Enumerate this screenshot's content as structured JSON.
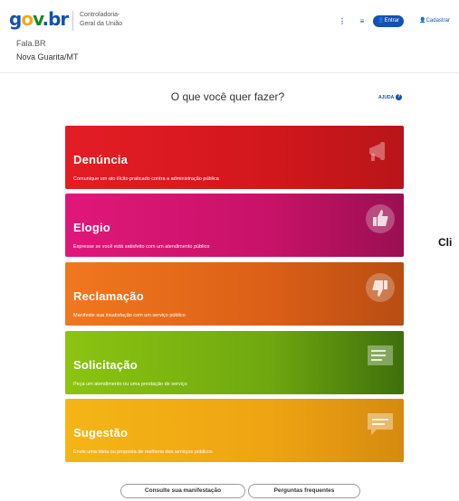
{
  "header": {
    "logo": {
      "g": "g",
      "o": "o",
      "v": "v",
      "br": ".br"
    },
    "org_line1": "Controladoria-",
    "org_line2": "Geral da União",
    "system": "Fala.BR",
    "city": "Nova Guarita/MT",
    "kebab": "⋮",
    "menu": "≡",
    "entrar": "Entrar",
    "cadastrar": "Cadastrar"
  },
  "main": {
    "question": "O que você quer fazer?",
    "help": "AJUDA",
    "help_icon": "?"
  },
  "cards": [
    {
      "title": "Denúncia",
      "desc": "Comunique um ato ilícito praticado contra a administração pública",
      "icon": "megaphone-icon",
      "color": "#d2171c"
    },
    {
      "title": "Elogio",
      "desc": "Expresse se você está satisfeito com um atendimento público",
      "icon": "thumbs-up-icon",
      "color": "#c81268"
    },
    {
      "title": "Reclamação",
      "desc": "Manifeste sua insatisfação com um serviço público",
      "icon": "thumbs-down-icon",
      "color": "#dc5f17"
    },
    {
      "title": "Solicitação",
      "desc": "Peça um atendimento ou uma prestação de serviço",
      "icon": "form-icon",
      "color": "#6fa80f"
    },
    {
      "title": "Sugestão",
      "desc": "Envie uma ideia ou proposta de melhoria dos serviços públicos",
      "icon": "chat-bubble-icon",
      "color": "#efa413"
    }
  ],
  "side_text": "Cli",
  "footer": {
    "consult": "Consulte sua manifestação",
    "faq": "Perguntas frequentes"
  }
}
